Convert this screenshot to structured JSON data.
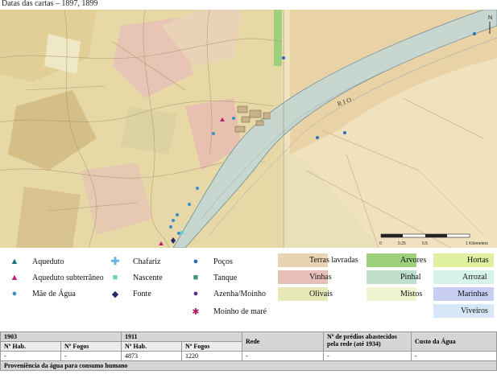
{
  "caption": "Datas das cartas – 1897, 1899",
  "map": {
    "river_label": "R I O",
    "north_label": "N",
    "scale_ticks": [
      "0",
      "0.25",
      "0.5",
      "",
      "1 Kilometers"
    ]
  },
  "legend": {
    "symbols": [
      {
        "label": "Aqueduto",
        "icon": "triangle",
        "color": "#1a6f7a"
      },
      {
        "label": "Aqueduto subterrâneo",
        "icon": "triangle",
        "color": "#c0207c"
      },
      {
        "label": "Mãe de Água",
        "icon": "circle",
        "color": "#3a8ec8"
      },
      {
        "label": "Chafariz",
        "icon": "cross",
        "color": "#69b8e4"
      },
      {
        "label": "Nascente",
        "icon": "square",
        "color": "#6fd0c8"
      },
      {
        "label": "Fonte",
        "icon": "diamond",
        "color": "#1f2a6b"
      },
      {
        "label": "Poços",
        "icon": "circle",
        "color": "#2c6fba"
      },
      {
        "label": "Tanque",
        "icon": "square",
        "color": "#3a9a6c"
      },
      {
        "label": "Azenha/Moinho",
        "icon": "circle",
        "color": "#5a2a86"
      },
      {
        "label": "Moinho de maré",
        "icon": "star",
        "color": "#b0186a"
      }
    ],
    "landuse": [
      {
        "label": "Terras lavradas",
        "color": "#e9d3b2"
      },
      {
        "label": "Vinhas",
        "color": "#e8bfb8"
      },
      {
        "label": "Olivais",
        "color": "#e6e8b8"
      },
      {
        "label": "Arvores",
        "color": "#9cd07d"
      },
      {
        "label": "Pinhal",
        "color": "#bfdfcc"
      },
      {
        "label": "Mistos",
        "color": "#f0f4d0"
      },
      {
        "label": "Hortas",
        "color": "#dff0a0"
      },
      {
        "label": "Arrozal",
        "color": "#d8f4ea"
      },
      {
        "label": "Marinhas",
        "color": "#c8cdf2"
      },
      {
        "label": "Viveiros",
        "color": "#d6e8f8"
      }
    ]
  },
  "table": {
    "year1": "1903",
    "year2": "1911",
    "col_nhab": "Nº Hab.",
    "col_nfogos": "Nº Fogos",
    "col_rede": "Rede",
    "col_predios": "Nº de prédios abastecidos pela rede (até 1934)",
    "col_custo": "Custo da Água",
    "row": [
      "-",
      "-",
      "4873",
      "1220",
      "-",
      "-",
      "-"
    ],
    "footer": "Proveniência da água para consumo humano"
  }
}
